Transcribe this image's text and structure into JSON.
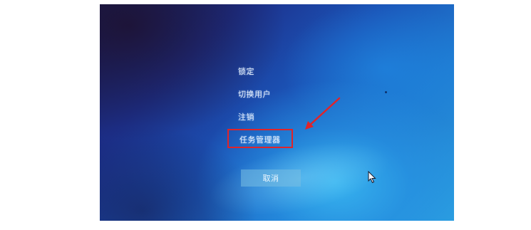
{
  "screen": {
    "menu": {
      "lock_label": "锁定",
      "switch_user_label": "切换用户",
      "sign_out_label": "注销",
      "task_manager_label": "任务管理器"
    },
    "cancel_label": "取消"
  },
  "colors": {
    "annotation_red": "#e0242a",
    "background_blue": "#1f7ad0",
    "menu_text": "#e8f2ff"
  },
  "icons": {
    "pointer": "mouse-pointer-icon",
    "annotation": "red-arrow-annotation"
  }
}
